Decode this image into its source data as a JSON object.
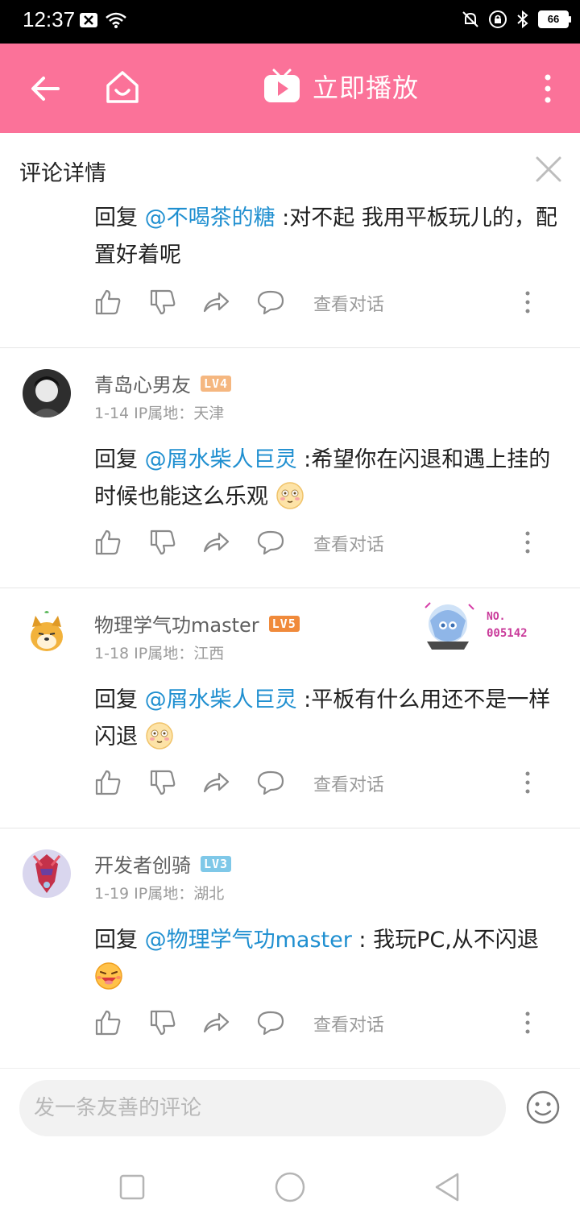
{
  "status": {
    "time": "12:37",
    "battery": "66"
  },
  "header": {
    "title": "立即播放"
  },
  "detail": {
    "title": "评论详情"
  },
  "comments": [
    {
      "reply_prefix": "回复 ",
      "mention": "@不喝茶的糖",
      "text": " :对不起 我用平板玩儿的，配置好着呢",
      "view_label": "查看对话"
    },
    {
      "user": "青岛心男友",
      "level": "LV4",
      "meta": "1-14  IP属地：天津",
      "reply_prefix": "回复 ",
      "mention": "@屑水柴人巨灵",
      "text": " :希望你在闪退和遇上挂的时候也能这么乐观",
      "view_label": "查看对话"
    },
    {
      "user": "物理学气功master",
      "level": "LV5",
      "meta": "1-18  IP属地：江西",
      "reply_prefix": "回复 ",
      "mention": "@屑水柴人巨灵",
      "text": " :平板有什么用还不是一样闪退",
      "view_label": "查看对话",
      "badge_no": "NO.",
      "badge_num": "005142"
    },
    {
      "user": "开发者创骑",
      "level": "LV3",
      "meta": "1-19  IP属地：湖北",
      "reply_prefix": "回复 ",
      "mention": "@物理学气功master",
      "text": " : 我玩PC,从不闪退",
      "view_label": "查看对话"
    }
  ],
  "input": {
    "placeholder": "发一条友善的评论"
  },
  "colors": {
    "brand": "#fb7299",
    "mention": "#1f8fd0",
    "lv3": "#7fc8e8",
    "lv4": "#f5b780",
    "lv5": "#f08a3b"
  },
  "icons": [
    "back-arrow-icon",
    "home-icon",
    "tv-play-icon",
    "more-vertical-icon",
    "close-icon",
    "thumb-up-icon",
    "thumb-down-icon",
    "share-icon",
    "comment-icon",
    "emoji-icon",
    "square-icon",
    "circle-icon",
    "triangle-back-icon"
  ]
}
